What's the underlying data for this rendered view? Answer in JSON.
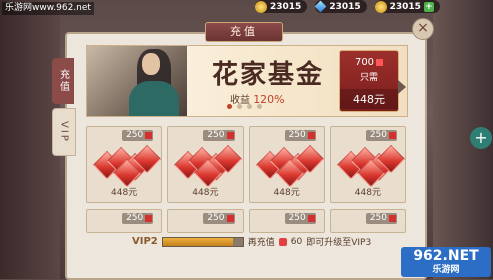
{
  "watermark_top": "乐游网www.962.net",
  "currencies": [
    {
      "icon": "coin-icon",
      "value": "23015"
    },
    {
      "icon": "gem-icon",
      "value": "23015"
    },
    {
      "icon": "coin-icon",
      "value": "23015"
    }
  ],
  "title": "充值",
  "side_tabs": [
    {
      "label": "充值"
    },
    {
      "label": "VIP"
    }
  ],
  "banner": {
    "title": "花家基金",
    "subtitle_prefix": "收益",
    "subtitle_value": "120%",
    "price_top": "700",
    "need_label": "只需",
    "price_bottom": "448元"
  },
  "packs": [
    {
      "bonus": "250",
      "price": "448元"
    },
    {
      "bonus": "250",
      "price": "448元"
    },
    {
      "bonus": "250",
      "price": "448元"
    },
    {
      "bonus": "250",
      "price": "448元"
    },
    {
      "bonus": "250",
      "price": ""
    },
    {
      "bonus": "250",
      "price": ""
    },
    {
      "bonus": "250",
      "price": ""
    },
    {
      "bonus": "250",
      "price": ""
    }
  ],
  "vip": {
    "level": "VIP2",
    "progress": 0.88,
    "text_before": "再充值",
    "amount": "60",
    "text_after": "即可升级至VIP3"
  },
  "watermark_bottom": {
    "logo": "962.NET",
    "caption": "乐游网"
  }
}
